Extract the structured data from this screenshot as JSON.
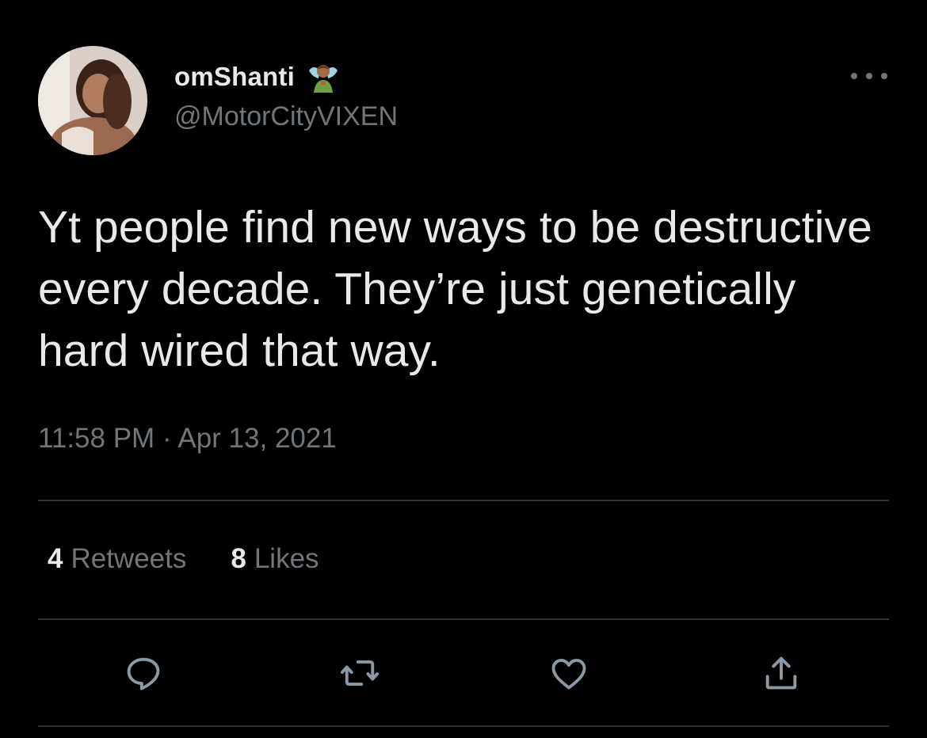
{
  "author": {
    "display_name": "omShanti",
    "name_emoji": "person-with-halo-emoji",
    "handle": "@MotorCityVIXEN",
    "avatar": "profile-photo"
  },
  "tweet": {
    "text": "Yt people find new ways to be destructive every decade. They’re just genetically hard wired that way.",
    "timestamp": "11:58 PM · Apr 13, 2021"
  },
  "stats": {
    "retweets_count": "4",
    "retweets_label": "Retweets",
    "likes_count": "8",
    "likes_label": "Likes"
  },
  "actions": [
    {
      "icon": "reply-icon"
    },
    {
      "icon": "retweet-icon"
    },
    {
      "icon": "like-icon"
    },
    {
      "icon": "share-icon"
    }
  ],
  "colors": {
    "background": "#000000",
    "primary_text": "#e7e9ea",
    "secondary_text": "#71767b",
    "divider": "#2f3336"
  }
}
